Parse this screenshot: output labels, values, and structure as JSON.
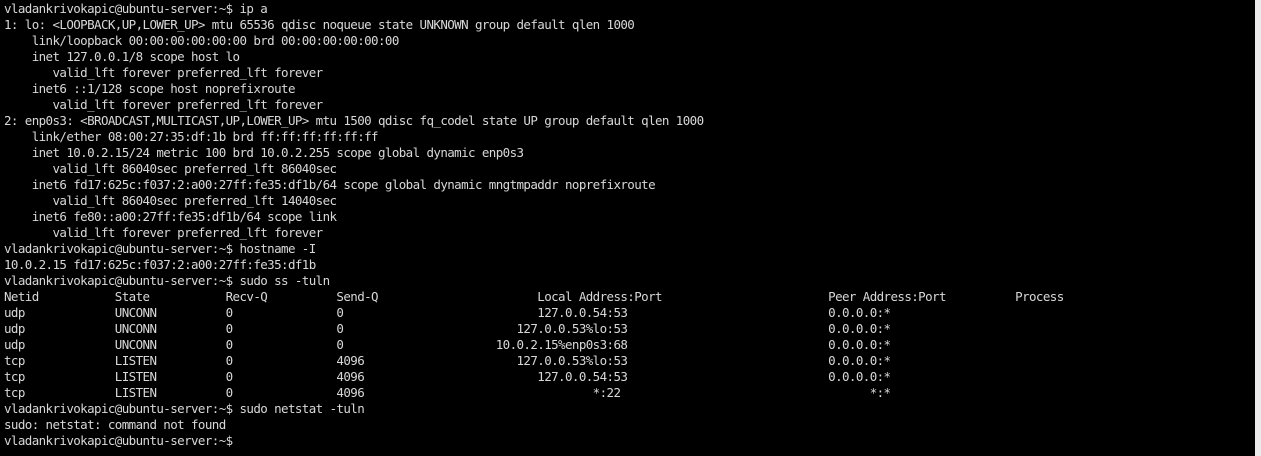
{
  "terminal": {
    "colors": {
      "background": "#000000",
      "foreground": "#d8d8d8",
      "scrollbar": "#ececec"
    },
    "lines": [
      "vladankrivokapic@ubuntu-server:~$ ip a",
      "1: lo: <LOOPBACK,UP,LOWER_UP> mtu 65536 qdisc noqueue state UNKNOWN group default qlen 1000",
      "    link/loopback 00:00:00:00:00:00 brd 00:00:00:00:00:00",
      "    inet 127.0.0.1/8 scope host lo",
      "       valid_lft forever preferred_lft forever",
      "    inet6 ::1/128 scope host noprefixroute",
      "       valid_lft forever preferred_lft forever",
      "2: enp0s3: <BROADCAST,MULTICAST,UP,LOWER_UP> mtu 1500 qdisc fq_codel state UP group default qlen 1000",
      "    link/ether 08:00:27:35:df:1b brd ff:ff:ff:ff:ff:ff",
      "    inet 10.0.2.15/24 metric 100 brd 10.0.2.255 scope global dynamic enp0s3",
      "       valid_lft 86040sec preferred_lft 86040sec",
      "    inet6 fd17:625c:f037:2:a00:27ff:fe35:df1b/64 scope global dynamic mngtmpaddr noprefixroute",
      "       valid_lft 86040sec preferred_lft 14040sec",
      "    inet6 fe80::a00:27ff:fe35:df1b/64 scope link",
      "       valid_lft forever preferred_lft forever",
      "vladankrivokapic@ubuntu-server:~$ hostname -I",
      "10.0.2.15 fd17:625c:f037:2:a00:27ff:fe35:df1b",
      "vladankrivokapic@ubuntu-server:~$ sudo ss -tuln",
      "Netid           State           Recv-Q          Send-Q                       Local Address:Port                        Peer Address:Port          Process",
      "udp             UNCONN          0               0                            127.0.0.54:53                             0.0.0.0:*",
      "udp             UNCONN          0               0                         127.0.0.53%lo:53                             0.0.0.0:*",
      "udp             UNCONN          0               0                      10.0.2.15%enp0s3:68                             0.0.0.0:*",
      "tcp             LISTEN          0               4096                      127.0.0.53%lo:53                             0.0.0.0:*",
      "tcp             LISTEN          0               4096                         127.0.0.54:53                             0.0.0.0:*",
      "tcp             LISTEN          0               4096                                 *:22                                    *:*",
      "vladankrivokapic@ubuntu-server:~$ sudo netstat -tuln",
      "sudo: netstat: command not found",
      "vladankrivokapic@ubuntu-server:~$ "
    ]
  }
}
